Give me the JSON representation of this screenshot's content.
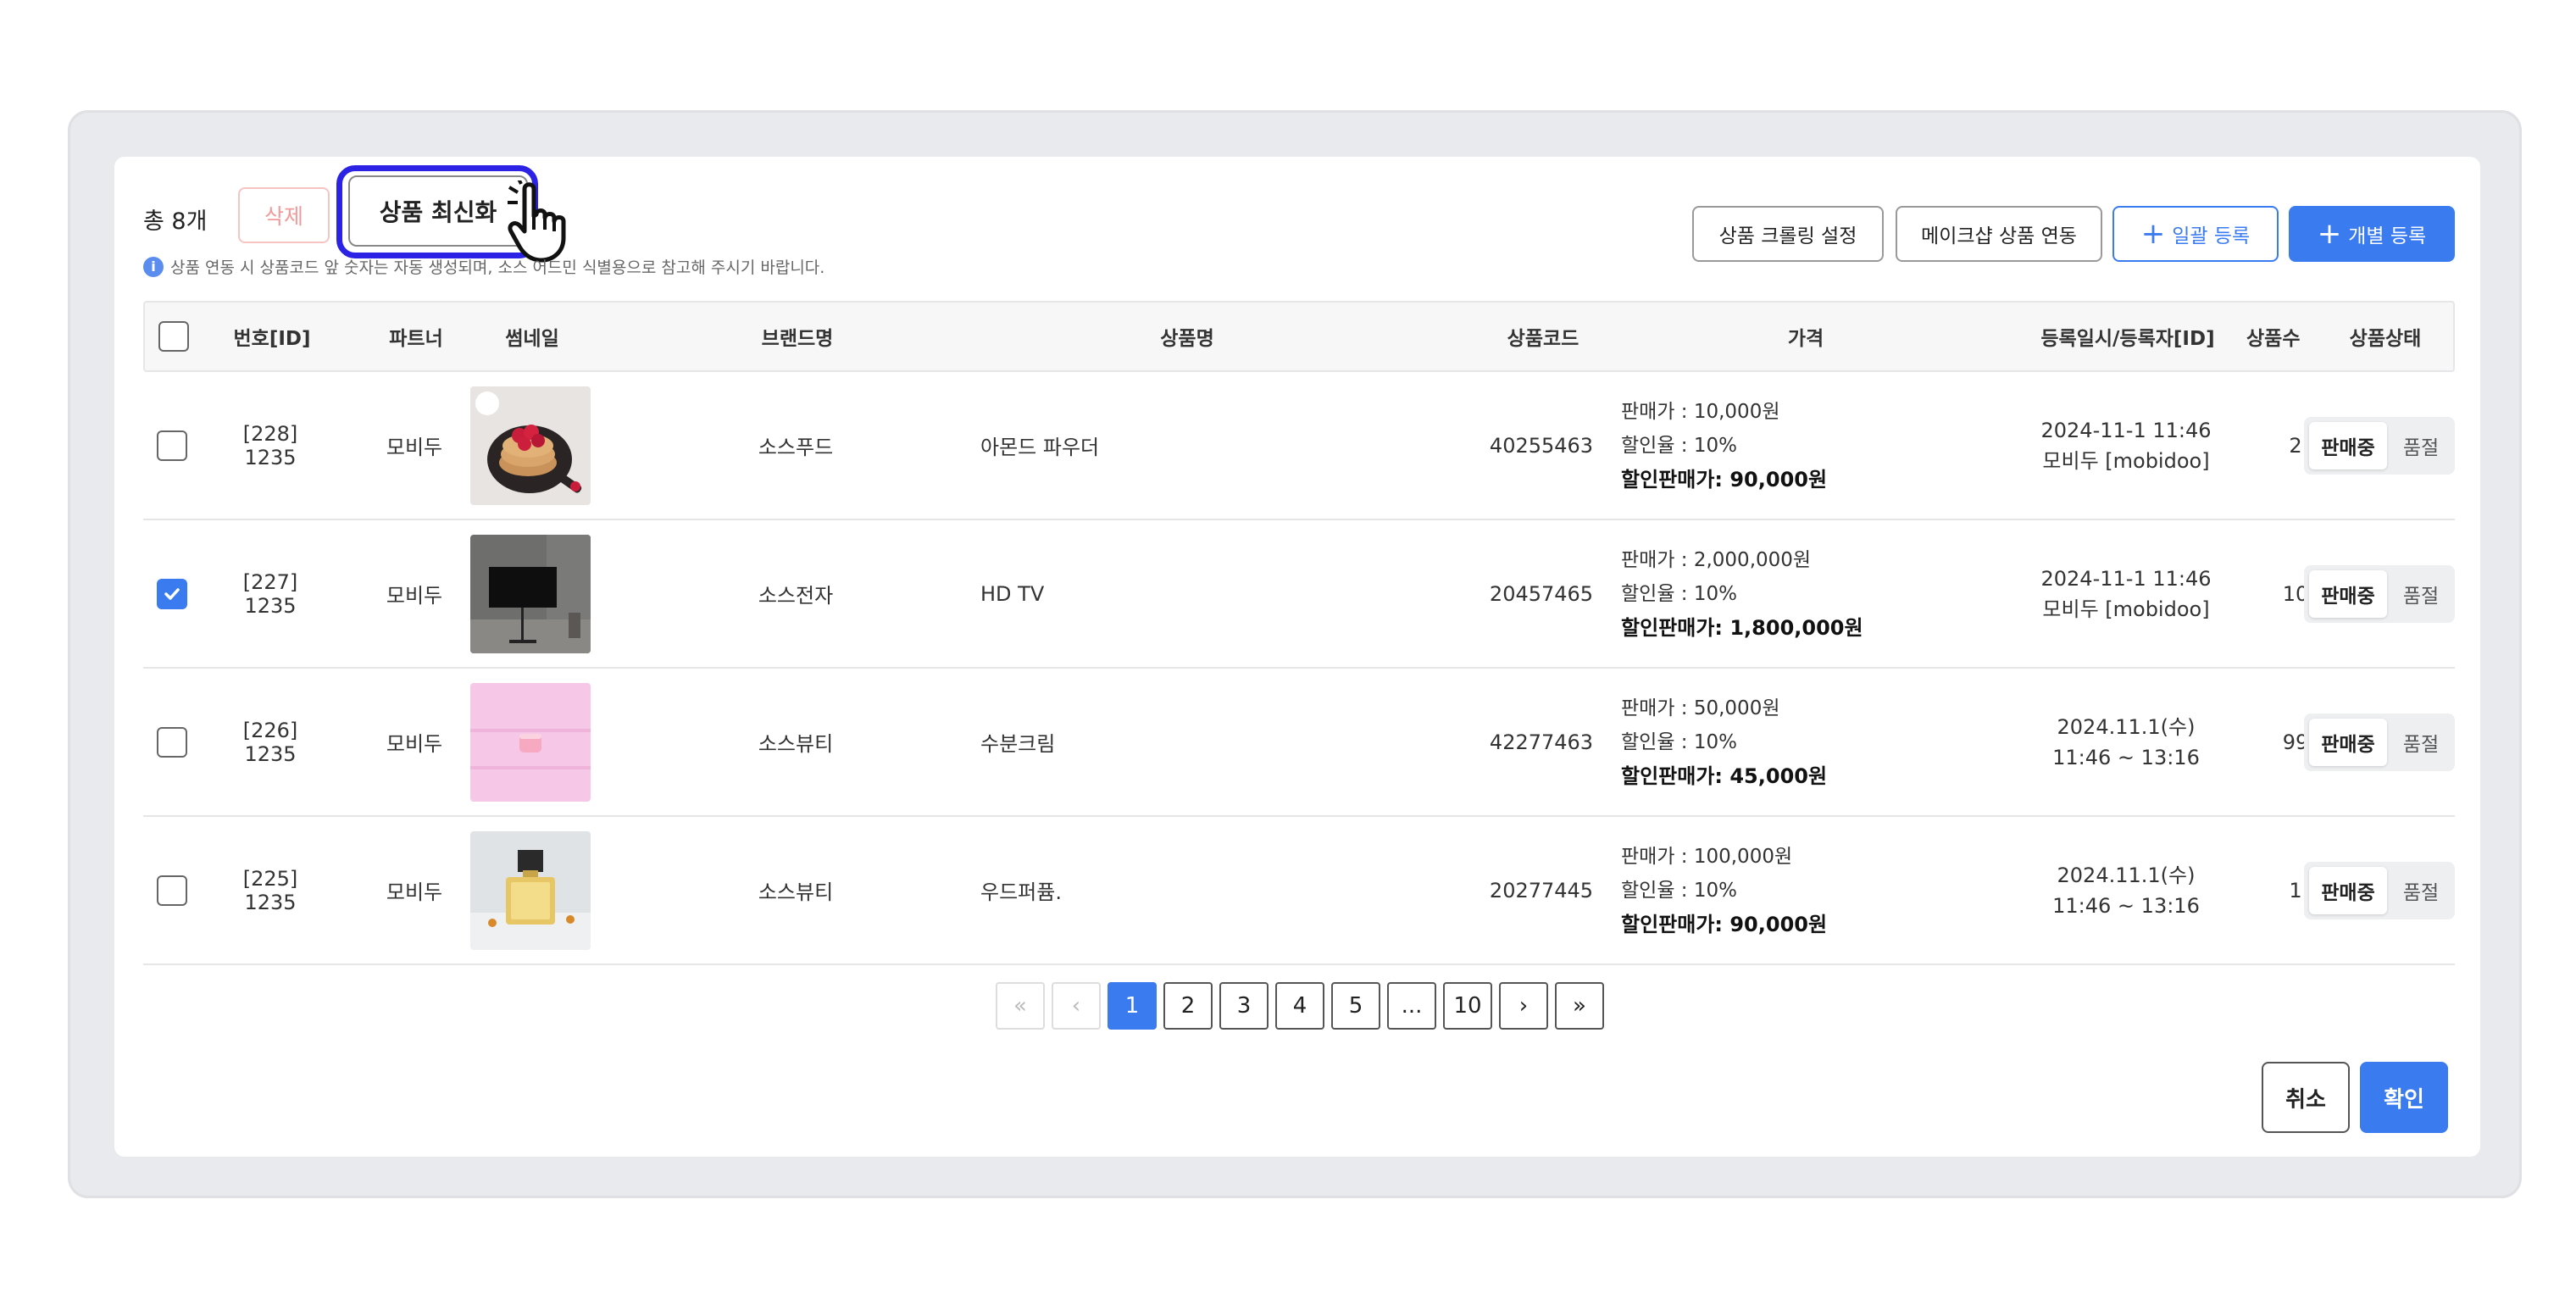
{
  "toolbar": {
    "total_label": "총 8개",
    "delete_label": "삭제",
    "refresh_label": "상품 최신화",
    "notice": "상품 연동 시 상품코드 앞 숫자는 자동 생성되며, 소스 어드민 식별용으로 참고해 주시기 바랍니다.",
    "crawl_label": "상품 크롤링 설정",
    "makeshop_label": "메이크샵 상품 연동",
    "bulk_label": "일괄 등록",
    "single_label": "개별 등록"
  },
  "table": {
    "headers": {
      "id": "번호[ID]",
      "partner": "파트너",
      "thumb": "썸네일",
      "brand": "브랜드명",
      "name": "상품명",
      "code": "상품코드",
      "price": "가격",
      "reg": "등록일시/등록자[ID]",
      "count": "상품수",
      "status": "상품상태"
    },
    "rows": [
      {
        "id": "[228]",
        "sub": "1235",
        "partner": "모비두",
        "brand": "소스푸드",
        "name": "아몬드 파우더",
        "code": "40255463",
        "price1": "판매가 : 10,000원",
        "price2": "할인율 : 10%",
        "price3": "할인판매가: 90,000원",
        "reg1": "2024-11-1 11:46",
        "reg2": "모비두 [mobidoo]",
        "count": "2",
        "on": "판매중",
        "off": "품절",
        "checked": false
      },
      {
        "id": "[227]",
        "sub": "1235",
        "partner": "모비두",
        "brand": "소스전자",
        "name": "HD TV",
        "code": "20457465",
        "price1": "판매가 : 2,000,000원",
        "price2": "할인율 : 10%",
        "price3": "할인판매가: 1,800,000원",
        "reg1": "2024-11-1 11:46",
        "reg2": "모비두 [mobidoo]",
        "count": "10",
        "on": "판매중",
        "off": "품절",
        "checked": true
      },
      {
        "id": "[226]",
        "sub": "1235",
        "partner": "모비두",
        "brand": "소스뷰티",
        "name": "수분크림",
        "code": "42277463",
        "price1": "판매가 : 50,000원",
        "price2": "할인율 : 10%",
        "price3": "할인판매가: 45,000원",
        "reg1": "2024.11.1(수)",
        "reg2": "11:46 ~ 13:16",
        "count": "99",
        "on": "판매중",
        "off": "품절",
        "checked": false
      },
      {
        "id": "[225]",
        "sub": "1235",
        "partner": "모비두",
        "brand": "소스뷰티",
        "name": "우드퍼퓸.",
        "code": "20277445",
        "price1": "판매가 : 100,000원",
        "price2": "할인율 : 10%",
        "price3": "할인판매가: 90,000원",
        "reg1": "2024.11.1(수)",
        "reg2": "11:46 ~ 13:16",
        "count": "1",
        "on": "판매중",
        "off": "품절",
        "checked": false
      }
    ]
  },
  "pagination": {
    "first": "«",
    "prev": "‹",
    "pages": [
      "1",
      "2",
      "3",
      "4",
      "5"
    ],
    "ellipsis": "...",
    "last_page": "10",
    "next": "›",
    "last": "»",
    "current": "1"
  },
  "footer": {
    "cancel_label": "취소",
    "confirm_label": "확인"
  },
  "colors": {
    "accent": "#3b7bf0",
    "highlight": "#2b22e6",
    "delete": "#f29a9a"
  }
}
